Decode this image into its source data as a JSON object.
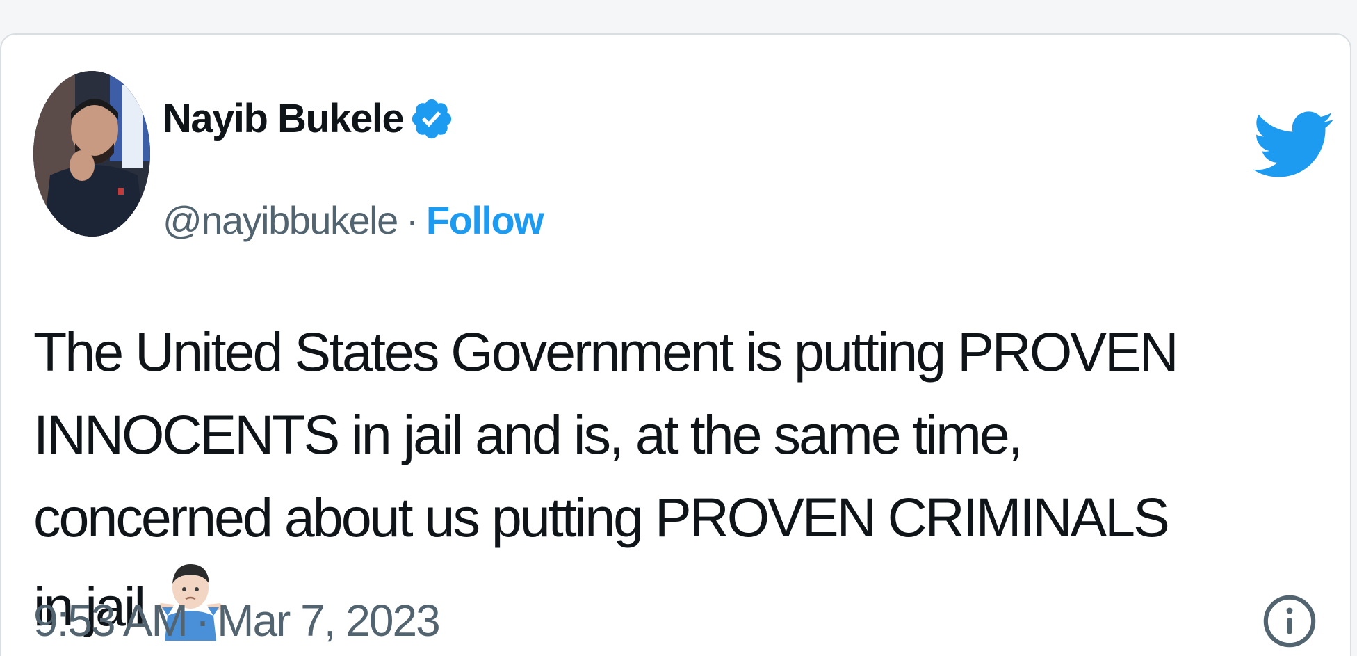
{
  "author": {
    "name": "Nayib Bukele",
    "handle": "@nayibbukele",
    "separator": "·",
    "follow_label": "Follow"
  },
  "tweet": {
    "text": "The United States Government is putting PROVEN INNOCENTS in jail and is, at the same time, concerned about us putting PROVEN CRIMINALS in jail",
    "emoji": "man-shrugging",
    "time": "9:53 AM",
    "date": "Mar 7, 2023",
    "separator": "·"
  },
  "colors": {
    "brand_blue": "#1d9bf0",
    "text_primary": "#0f1419",
    "text_secondary": "#536471",
    "border": "#d9dee2"
  },
  "icons": {
    "verified": "verified-badge-icon",
    "brand": "twitter-bird-icon",
    "info": "info-icon"
  }
}
